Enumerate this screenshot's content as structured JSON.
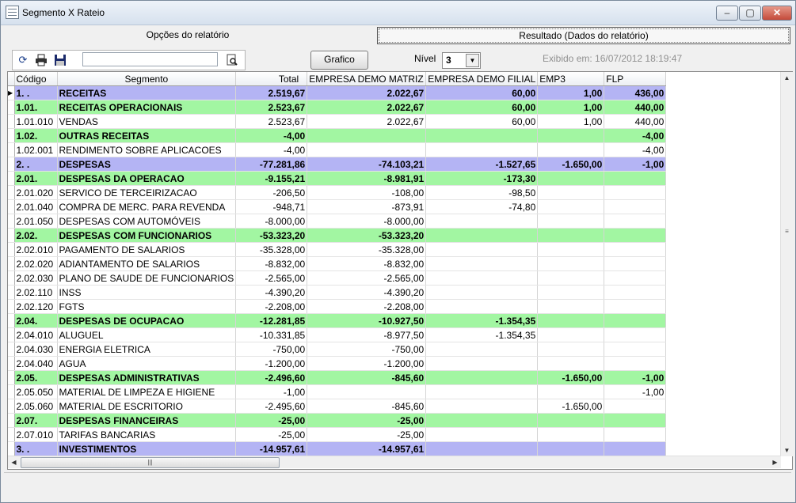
{
  "window": {
    "title": "Segmento X Rateio",
    "minimize_label": "–",
    "maximize_label": "▢",
    "close_label": "✕"
  },
  "tabs": {
    "options_label": "Opções do relatório",
    "result_label": "Resultado (Dados do relatório)"
  },
  "toolbar": {
    "icons": [
      "refresh-icon",
      "print-icon",
      "save-icon",
      "search-preview-icon"
    ],
    "search_value": "",
    "chart_button": "Grafico",
    "level_label": "Nível",
    "level_value": "3",
    "exhibited": "Exibido em: 16/07/2012 18:19:47"
  },
  "table": {
    "columns": [
      "Código",
      "Segmento",
      "Total",
      "EMPRESA DEMO MATRIZ",
      "EMPRESA DEMO FILIAL",
      "EMP3",
      "FLP"
    ],
    "rows": [
      {
        "level": 1,
        "code": "1. .",
        "segment": "RECEITAS",
        "total": "2.519,67",
        "matriz": "2.022,67",
        "filial": "60,00",
        "emp3": "1,00",
        "flp": "436,00"
      },
      {
        "level": 2,
        "code": "1.01.",
        "segment": "RECEITAS OPERACIONAIS",
        "total": "2.523,67",
        "matriz": "2.022,67",
        "filial": "60,00",
        "emp3": "1,00",
        "flp": "440,00"
      },
      {
        "level": 3,
        "code": "1.01.010",
        "segment": "VENDAS",
        "total": "2.523,67",
        "matriz": "2.022,67",
        "filial": "60,00",
        "emp3": "1,00",
        "flp": "440,00"
      },
      {
        "level": 2,
        "code": "1.02.",
        "segment": "OUTRAS RECEITAS",
        "total": "-4,00",
        "matriz": "",
        "filial": "",
        "emp3": "",
        "flp": "-4,00"
      },
      {
        "level": 3,
        "code": "1.02.001",
        "segment": "RENDIMENTO SOBRE APLICACOES",
        "total": "-4,00",
        "matriz": "",
        "filial": "",
        "emp3": "",
        "flp": "-4,00"
      },
      {
        "level": 1,
        "code": "2. .",
        "segment": "DESPESAS",
        "total": "-77.281,86",
        "matriz": "-74.103,21",
        "filial": "-1.527,65",
        "emp3": "-1.650,00",
        "flp": "-1,00"
      },
      {
        "level": 2,
        "code": "2.01.",
        "segment": "DESPESAS DA OPERACAO",
        "total": "-9.155,21",
        "matriz": "-8.981,91",
        "filial": "-173,30",
        "emp3": "",
        "flp": ""
      },
      {
        "level": 3,
        "code": "2.01.020",
        "segment": "SERVICO DE TERCEIRIZACAO",
        "total": "-206,50",
        "matriz": "-108,00",
        "filial": "-98,50",
        "emp3": "",
        "flp": ""
      },
      {
        "level": 3,
        "code": "2.01.040",
        "segment": "COMPRA DE MERC. PARA REVENDA",
        "total": "-948,71",
        "matriz": "-873,91",
        "filial": "-74,80",
        "emp3": "",
        "flp": ""
      },
      {
        "level": 3,
        "code": "2.01.050",
        "segment": "DESPESAS COM AUTOMÓVEIS",
        "total": "-8.000,00",
        "matriz": "-8.000,00",
        "filial": "",
        "emp3": "",
        "flp": ""
      },
      {
        "level": 2,
        "code": "2.02.",
        "segment": "DESPESAS COM FUNCIONARIOS",
        "total": "-53.323,20",
        "matriz": "-53.323,20",
        "filial": "",
        "emp3": "",
        "flp": ""
      },
      {
        "level": 3,
        "code": "2.02.010",
        "segment": "PAGAMENTO DE SALARIOS",
        "total": "-35.328,00",
        "matriz": "-35.328,00",
        "filial": "",
        "emp3": "",
        "flp": ""
      },
      {
        "level": 3,
        "code": "2.02.020",
        "segment": "ADIANTAMENTO DE SALARIOS",
        "total": "-8.832,00",
        "matriz": "-8.832,00",
        "filial": "",
        "emp3": "",
        "flp": ""
      },
      {
        "level": 3,
        "code": "2.02.030",
        "segment": "PLANO DE SAUDE DE FUNCIONARIOS",
        "total": "-2.565,00",
        "matriz": "-2.565,00",
        "filial": "",
        "emp3": "",
        "flp": ""
      },
      {
        "level": 3,
        "code": "2.02.110",
        "segment": "INSS",
        "total": "-4.390,20",
        "matriz": "-4.390,20",
        "filial": "",
        "emp3": "",
        "flp": ""
      },
      {
        "level": 3,
        "code": "2.02.120",
        "segment": "FGTS",
        "total": "-2.208,00",
        "matriz": "-2.208,00",
        "filial": "",
        "emp3": "",
        "flp": ""
      },
      {
        "level": 2,
        "code": "2.04.",
        "segment": "DESPESAS DE OCUPACAO",
        "total": "-12.281,85",
        "matriz": "-10.927,50",
        "filial": "-1.354,35",
        "emp3": "",
        "flp": ""
      },
      {
        "level": 3,
        "code": "2.04.010",
        "segment": "ALUGUEL",
        "total": "-10.331,85",
        "matriz": "-8.977,50",
        "filial": "-1.354,35",
        "emp3": "",
        "flp": ""
      },
      {
        "level": 3,
        "code": "2.04.030",
        "segment": "ENERGIA ELETRICA",
        "total": "-750,00",
        "matriz": "-750,00",
        "filial": "",
        "emp3": "",
        "flp": ""
      },
      {
        "level": 3,
        "code": "2.04.040",
        "segment": "AGUA",
        "total": "-1.200,00",
        "matriz": "-1.200,00",
        "filial": "",
        "emp3": "",
        "flp": ""
      },
      {
        "level": 2,
        "code": "2.05.",
        "segment": "DESPESAS ADMINISTRATIVAS",
        "total": "-2.496,60",
        "matriz": "-845,60",
        "filial": "",
        "emp3": "-1.650,00",
        "flp": "-1,00"
      },
      {
        "level": 3,
        "code": "2.05.050",
        "segment": "MATERIAL DE LIMPEZA E HIGIENE",
        "total": "-1,00",
        "matriz": "",
        "filial": "",
        "emp3": "",
        "flp": "-1,00"
      },
      {
        "level": 3,
        "code": "2.05.060",
        "segment": "MATERIAL DE ESCRITORIO",
        "total": "-2.495,60",
        "matriz": "-845,60",
        "filial": "",
        "emp3": "-1.650,00",
        "flp": ""
      },
      {
        "level": 2,
        "code": "2.07.",
        "segment": "DESPESAS FINANCEIRAS",
        "total": "-25,00",
        "matriz": "-25,00",
        "filial": "",
        "emp3": "",
        "flp": ""
      },
      {
        "level": 3,
        "code": "2.07.010",
        "segment": "TARIFAS BANCARIAS",
        "total": "-25,00",
        "matriz": "-25,00",
        "filial": "",
        "emp3": "",
        "flp": ""
      },
      {
        "level": 1,
        "code": "3. .",
        "segment": "INVESTIMENTOS",
        "total": "-14.957,61",
        "matriz": "-14.957,61",
        "filial": "",
        "emp3": "",
        "flp": ""
      }
    ]
  },
  "colors": {
    "level1": "#b4b4f4",
    "level2": "#a2f6a2"
  }
}
